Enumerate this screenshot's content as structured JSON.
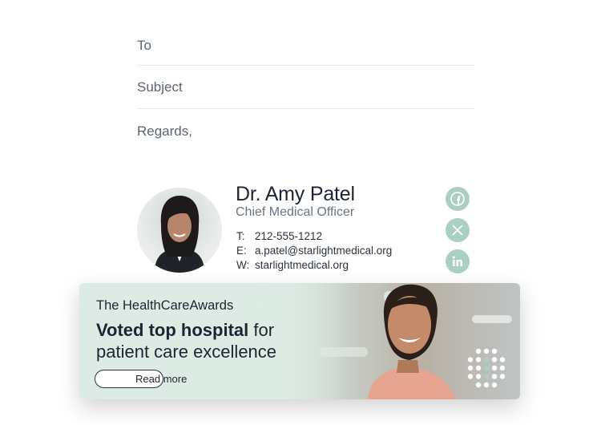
{
  "compose": {
    "to_label": "To",
    "subject_label": "Subject",
    "body_text": "Regards,"
  },
  "signature": {
    "name": "Dr. Amy Patel",
    "title": "Chief Medical Officer",
    "contacts": [
      {
        "key": "T:",
        "value": "212-555-1212"
      },
      {
        "key": "E:",
        "value": "a.patel@starlightmedical.org"
      },
      {
        "key": "W:",
        "value": "starlightmedical.org"
      }
    ],
    "social": [
      "facebook-icon",
      "x-icon",
      "linkedin-icon"
    ],
    "social_color": "#a9d0c3"
  },
  "banner": {
    "brand": "The HealthCareAwards",
    "headline_bold": "Voted top hospital",
    "headline_rest1": " for",
    "headline_line2": "patient care excellence",
    "cta_label": "Read more"
  }
}
